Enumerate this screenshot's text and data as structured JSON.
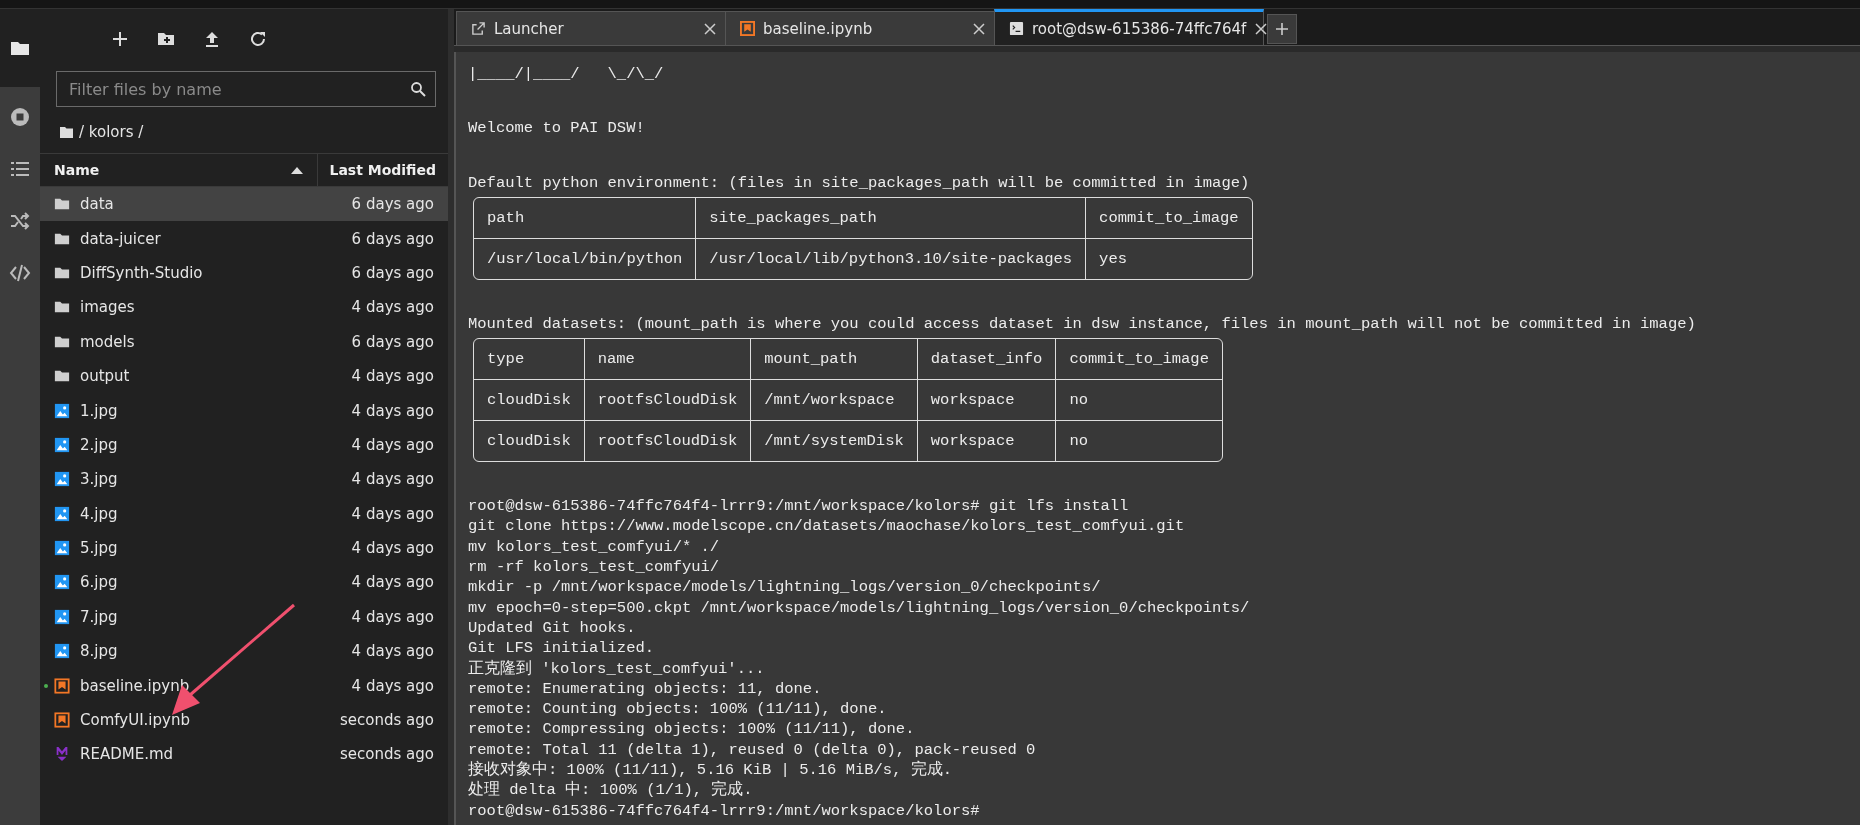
{
  "activity_bar": {
    "items": [
      {
        "kind": "folder",
        "selected": true
      },
      {
        "kind": "stop",
        "selected": false
      },
      {
        "kind": "list",
        "selected": false
      },
      {
        "kind": "shuffle",
        "selected": false
      },
      {
        "kind": "code",
        "selected": false
      }
    ]
  },
  "file_browser": {
    "search": {
      "placeholder": "Filter files by name"
    },
    "breadcrumb": "/ kolors /",
    "columns": [
      "Name",
      "Last Modified"
    ],
    "rows": [
      {
        "name": "data",
        "modified": "6 days ago",
        "kind": "folder",
        "selected": true,
        "running": false
      },
      {
        "name": "data-juicer",
        "modified": "6 days ago",
        "kind": "folder",
        "selected": false,
        "running": false
      },
      {
        "name": "DiffSynth-Studio",
        "modified": "6 days ago",
        "kind": "folder",
        "selected": false,
        "running": false
      },
      {
        "name": "images",
        "modified": "4 days ago",
        "kind": "folder",
        "selected": false,
        "running": false
      },
      {
        "name": "models",
        "modified": "6 days ago",
        "kind": "folder",
        "selected": false,
        "running": false
      },
      {
        "name": "output",
        "modified": "4 days ago",
        "kind": "folder",
        "selected": false,
        "running": false
      },
      {
        "name": "1.jpg",
        "modified": "4 days ago",
        "kind": "image",
        "selected": false,
        "running": false
      },
      {
        "name": "2.jpg",
        "modified": "4 days ago",
        "kind": "image",
        "selected": false,
        "running": false
      },
      {
        "name": "3.jpg",
        "modified": "4 days ago",
        "kind": "image",
        "selected": false,
        "running": false
      },
      {
        "name": "4.jpg",
        "modified": "4 days ago",
        "kind": "image",
        "selected": false,
        "running": false
      },
      {
        "name": "5.jpg",
        "modified": "4 days ago",
        "kind": "image",
        "selected": false,
        "running": false
      },
      {
        "name": "6.jpg",
        "modified": "4 days ago",
        "kind": "image",
        "selected": false,
        "running": false
      },
      {
        "name": "7.jpg",
        "modified": "4 days ago",
        "kind": "image",
        "selected": false,
        "running": false
      },
      {
        "name": "8.jpg",
        "modified": "4 days ago",
        "kind": "image",
        "selected": false,
        "running": false
      },
      {
        "name": "baseline.ipynb",
        "modified": "4 days ago",
        "kind": "notebook",
        "selected": false,
        "running": true
      },
      {
        "name": "ComfyUI.ipynb",
        "modified": "seconds ago",
        "kind": "notebook",
        "selected": false,
        "running": false
      },
      {
        "name": "README.md",
        "modified": "seconds ago",
        "kind": "markdown",
        "selected": false,
        "running": false
      }
    ]
  },
  "tabs": [
    {
      "label": "Launcher",
      "kind": "launcher",
      "selected": false
    },
    {
      "label": "baseline.ipynb",
      "kind": "notebook",
      "selected": false
    },
    {
      "label": "root@dsw-615386-74ffc764f",
      "kind": "terminal",
      "selected": true
    }
  ],
  "terminal": {
    "blocks": [
      {
        "kind": "text",
        "lines": [
          "|____/|____/   \\_/\\_/"
        ]
      },
      {
        "kind": "text",
        "lines": [
          "Welcome to PAI DSW!"
        ]
      },
      {
        "kind": "text",
        "lines": [
          "Default python environment: (files in site_packages_path will be committed in image)"
        ]
      },
      {
        "kind": "table",
        "rows": [
          [
            "path",
            "site_packages_path",
            "commit_to_image"
          ],
          [
            "/usr/local/bin/python",
            "/usr/local/lib/python3.10/site-packages",
            "yes"
          ]
        ]
      },
      {
        "kind": "text",
        "lines": [
          "Mounted datasets: (mount_path is where you could access dataset in dsw instance, files in mount_path will not be committed in image)"
        ]
      },
      {
        "kind": "table",
        "rows": [
          [
            "type",
            "name",
            "mount_path",
            "dataset_info",
            "commit_to_image"
          ],
          [
            "cloudDisk",
            "rootfsCloudDisk",
            "/mnt/workspace",
            "workspace",
            "no"
          ],
          [
            "cloudDisk",
            "rootfsCloudDisk",
            "/mnt/systemDisk",
            "workspace",
            "no"
          ]
        ]
      },
      {
        "kind": "text",
        "lines": [
          "root@dsw-615386-74ffc764f4-lrrr9:/mnt/workspace/kolors# git lfs install",
          "git clone https://www.modelscope.cn/datasets/maochase/kolors_test_comfyui.git",
          "mv kolors_test_comfyui/* ./",
          "rm -rf kolors_test_comfyui/",
          "mkdir -p /mnt/workspace/models/lightning_logs/version_0/checkpoints/",
          "mv epoch=0-step=500.ckpt /mnt/workspace/models/lightning_logs/version_0/checkpoints/",
          "Updated Git hooks.",
          "Git LFS initialized.",
          "正克隆到 'kolors_test_comfyui'...",
          "remote: Enumerating objects: 11, done.",
          "remote: Counting objects: 100% (11/11), done.",
          "remote: Compressing objects: 100% (11/11), done.",
          "remote: Total 11 (delta 1), reused 0 (delta 0), pack-reused 0",
          "接收对象中: 100% (11/11), 5.16 KiB | 5.16 MiB/s, 完成.",
          "处理 delta 中: 100% (1/1), 完成.",
          "root@dsw-615386-74ffc764f4-lrrr9:/mnt/workspace/kolors#"
        ]
      }
    ]
  }
}
